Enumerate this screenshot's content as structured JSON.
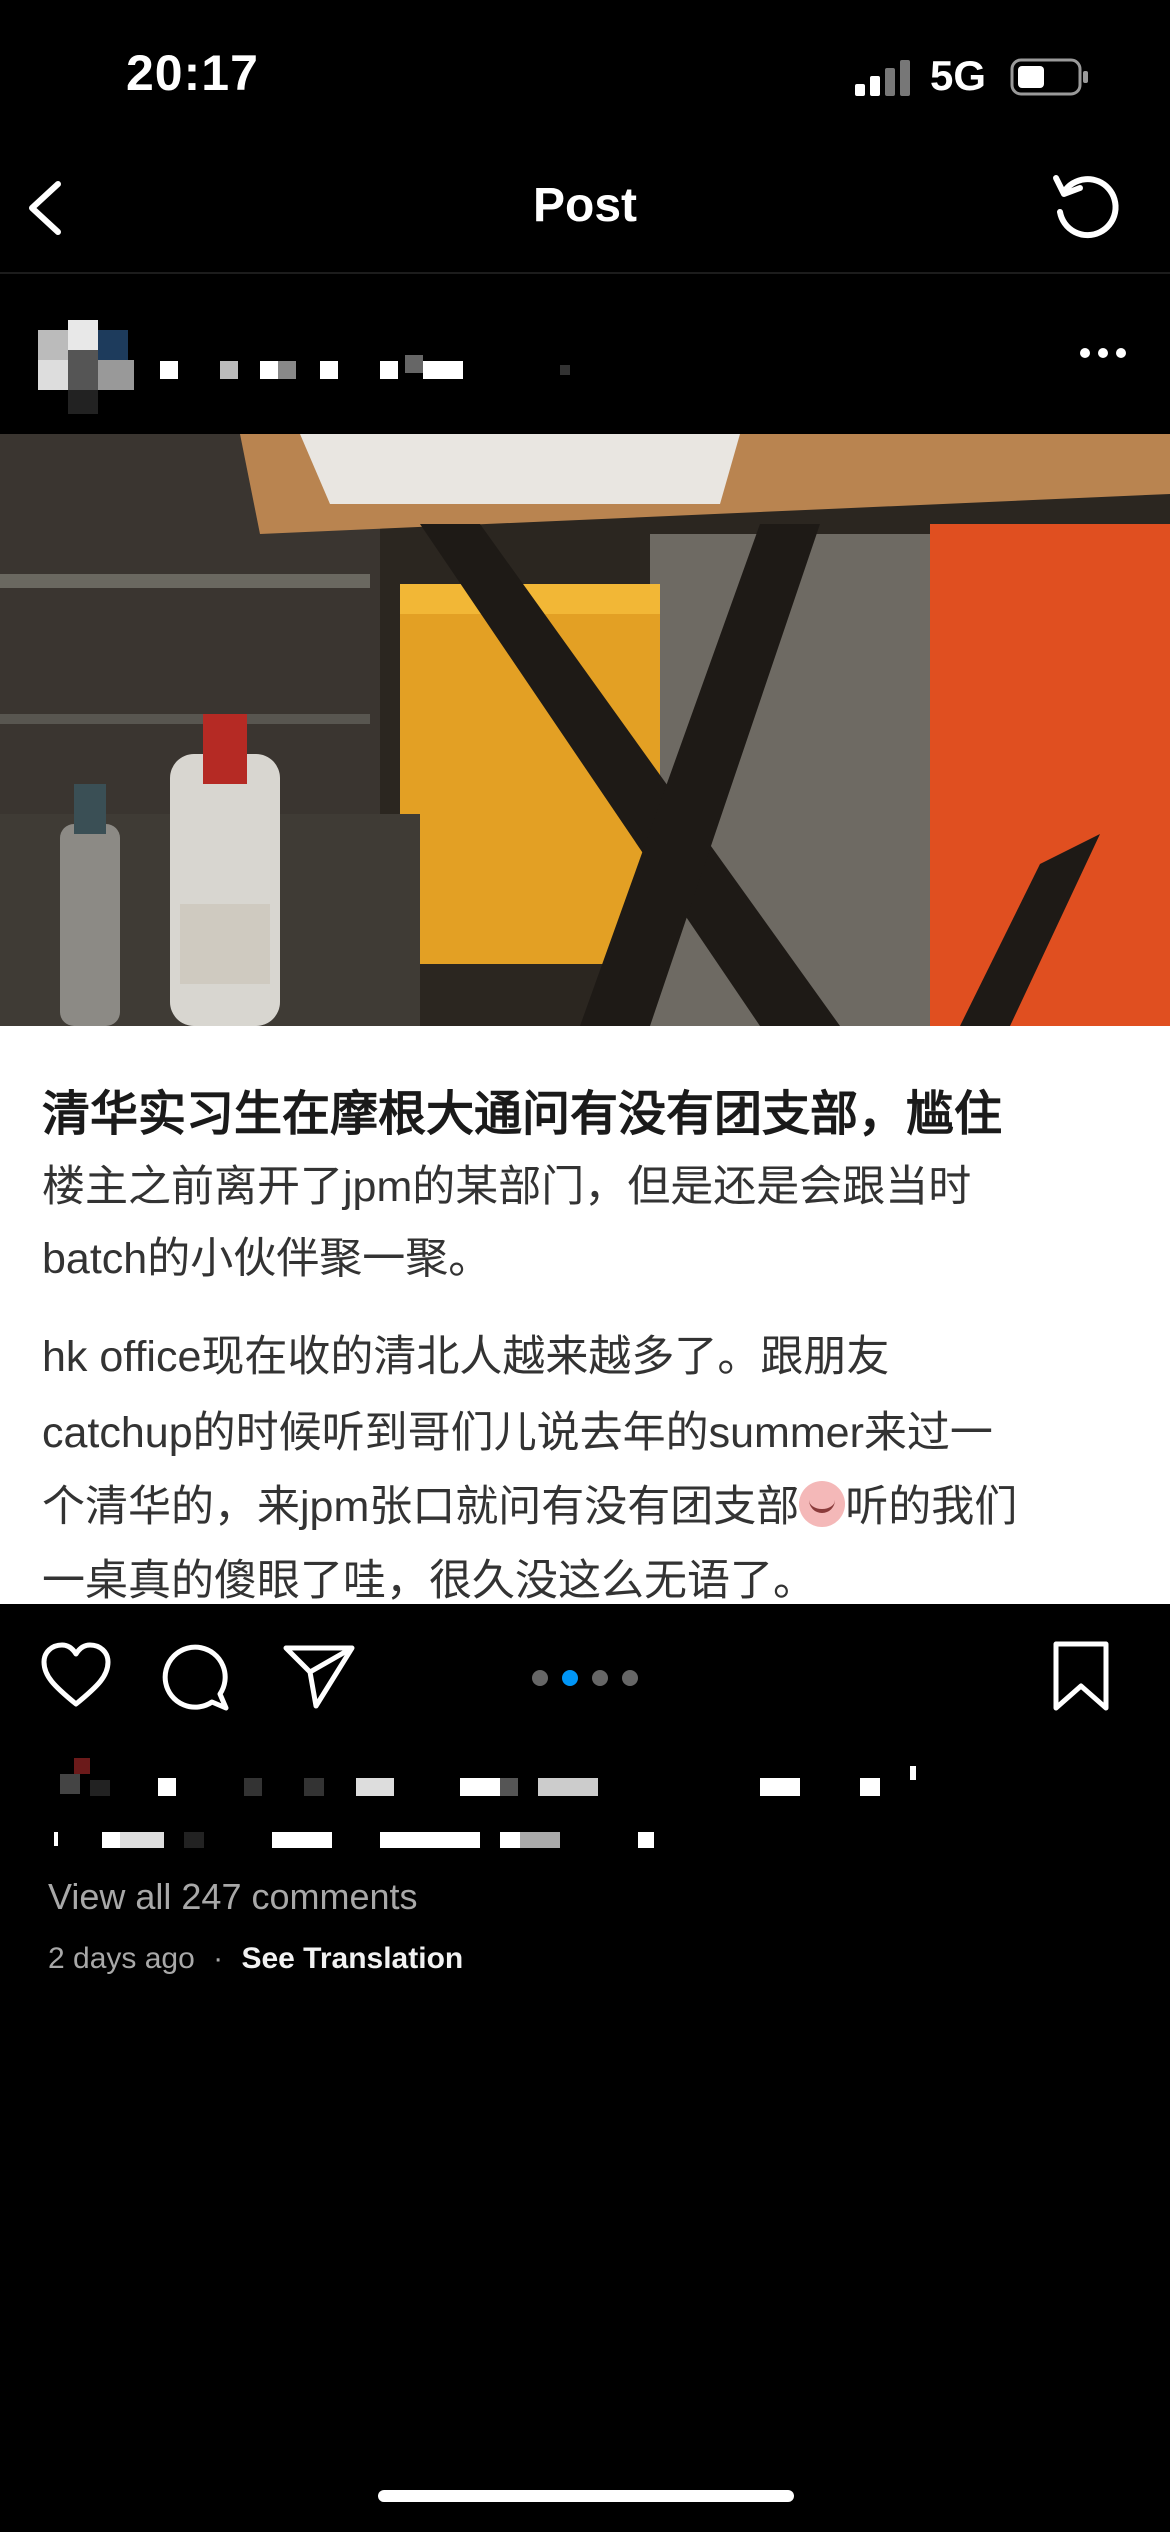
{
  "status_bar": {
    "time": "20:17",
    "network": "5G"
  },
  "nav": {
    "title": "Post"
  },
  "post": {
    "text_card": {
      "title": "清华实习生在摩根大通问有没有团支部，尴住",
      "lines": [
        "楼主之前离开了jpm的某部门，但是还是会跟当时",
        "batch的小伙伴聚一聚。",
        "hk office现在收的清北人越来越多了。跟朋友",
        "catchup的时候听到哥们儿说去年的summer来过一",
        "个清华的，来jpm张口就问有没有团支部",
        "听的我们",
        "一桌真的傻眼了哇，很久没这么无语了。"
      ]
    },
    "carousel": {
      "count": 4,
      "active_index": 1
    },
    "comments_link": "View all 247 comments",
    "timestamp": "2 days ago",
    "separator": "·",
    "see_translation": "See Translation"
  },
  "colors": {
    "accent": "#0095f6",
    "background": "#000000"
  }
}
